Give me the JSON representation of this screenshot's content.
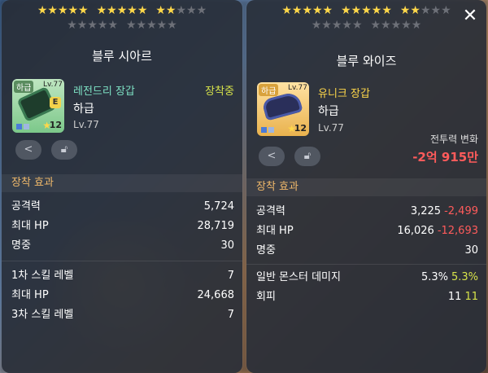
{
  "left": {
    "stars_top": {
      "on": 12,
      "off": 3
    },
    "stars_bottom": {
      "count": 10
    },
    "title": "블루 시아르",
    "icon": {
      "grade": "하급",
      "level": "Lv.77",
      "enhance": "12",
      "badge": "E"
    },
    "type": "레전드리 장갑",
    "equip_status": "장착중",
    "grade": "하급",
    "level": "Lv.77",
    "section": "장착 효과",
    "stats": [
      {
        "label": "공격력",
        "value": "5,724"
      },
      {
        "label": "최대 HP",
        "value": "28,719"
      },
      {
        "label": "명중",
        "value": "30"
      }
    ],
    "potential": [
      {
        "label": "1차 스킬 레벨",
        "value": "7"
      },
      {
        "label": "최대 HP",
        "value": "24,668"
      },
      {
        "label": "3차 스킬 레벨",
        "value": "7"
      }
    ]
  },
  "right": {
    "stars_top": {
      "on": 12,
      "off": 3
    },
    "stars_bottom": {
      "count": 10
    },
    "title": "블루 와이즈",
    "icon": {
      "grade": "하급",
      "level": "Lv.77",
      "enhance": "12"
    },
    "type": "유니크 장갑",
    "grade": "하급",
    "level": "Lv.77",
    "power_label": "전투력 변화",
    "power_value": "-2억 915만",
    "section": "장착 효과",
    "stats": [
      {
        "label": "공격력",
        "value": "3,225",
        "delta": "-2,499",
        "delta_type": "neg"
      },
      {
        "label": "최대 HP",
        "value": "16,026",
        "delta": "-12,693",
        "delta_type": "neg"
      },
      {
        "label": "명중",
        "value": "30",
        "delta": "",
        "delta_type": ""
      }
    ],
    "potential": [
      {
        "label": "일반 몬스터 데미지",
        "value": "5.3%",
        "delta": "5.3%",
        "delta_type": "pos"
      },
      {
        "label": "회피",
        "value": "11",
        "delta": "11",
        "delta_type": "pos"
      }
    ]
  },
  "icons": {
    "close": "close-icon",
    "share": "share-icon",
    "lock": "lock-icon",
    "star": "star-icon"
  }
}
